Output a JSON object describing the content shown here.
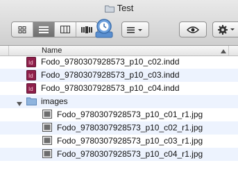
{
  "window": {
    "title": "Test"
  },
  "toolbar": {
    "view_buttons": [
      {
        "name": "icon-view-button",
        "icon": "grid-icon",
        "active": false
      },
      {
        "name": "list-view-button",
        "icon": "list-icon",
        "active": true
      },
      {
        "name": "column-view-button",
        "icon": "columns-icon",
        "active": false
      },
      {
        "name": "coverflow-view-button",
        "icon": "coverflow-icon",
        "active": false
      }
    ],
    "time_machine_icon": "time-machine-icon",
    "arrange_icon": "arrange-menu-icon",
    "quicklook_icon": "eye-icon",
    "action_icon": "gear-icon"
  },
  "columns": {
    "name": "Name"
  },
  "files": [
    {
      "label": "Fodo_9780307928573_p10_c02.indd",
      "icon": "indesign-icon"
    },
    {
      "label": "Fodo_9780307928573_p10_c03.indd",
      "icon": "indesign-icon"
    },
    {
      "label": "Fodo_9780307928573_p10_c04.indd",
      "icon": "indesign-icon"
    }
  ],
  "folder": {
    "label": "images",
    "expanded": true,
    "children": [
      {
        "label": "Fodo_9780307928573_p10_c01_r1.jpg",
        "icon": "jpg-icon"
      },
      {
        "label": "Fodo_9780307928573_p10_c02_r1.jpg",
        "icon": "jpg-icon"
      },
      {
        "label": "Fodo_9780307928573_p10_c03_r1.jpg",
        "icon": "jpg-icon"
      },
      {
        "label": "Fodo_9780307928573_p10_c04_r1.jpg",
        "icon": "jpg-icon"
      }
    ]
  },
  "colors": {
    "row_alt": "#edf3fe",
    "indesign": "#8e1f4a",
    "folder": "#8fb4de"
  }
}
